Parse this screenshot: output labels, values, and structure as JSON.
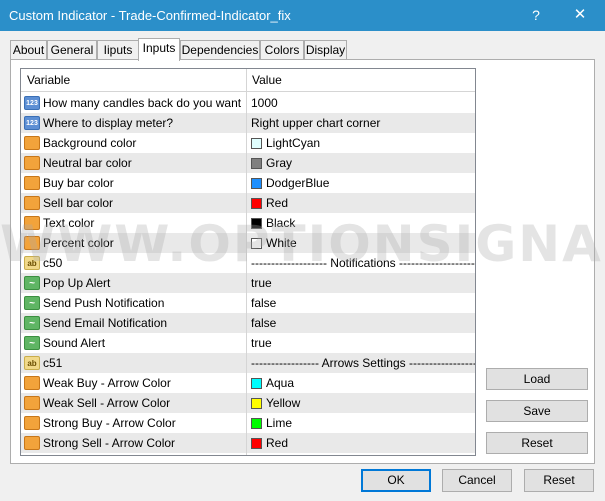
{
  "window": {
    "title": "Custom Indicator - Trade-Confirmed-Indicator_fix",
    "help_glyph": "?",
    "close_glyph": "✕"
  },
  "tabs": [
    "About",
    "General",
    "Iiputs",
    "Inputs",
    "Dependencies",
    "Colors",
    "Display"
  ],
  "active_tab": "Inputs",
  "grid": {
    "headers": {
      "variable": "Variable",
      "value": "Value"
    },
    "rows": [
      {
        "type": "num",
        "icon_text": "123",
        "variable": "How many candles back do you want in...",
        "value": "1000"
      },
      {
        "type": "num",
        "icon_text": "123",
        "variable": "Where to display meter?",
        "value": "Right upper chart corner"
      },
      {
        "type": "color",
        "variable": "Background color",
        "value": "LightCyan",
        "swatch": "#e0ffff"
      },
      {
        "type": "color",
        "variable": "Neutral bar color",
        "value": "Gray",
        "swatch": "#808080"
      },
      {
        "type": "color",
        "variable": "Buy bar color",
        "value": "DodgerBlue",
        "swatch": "#1e90ff"
      },
      {
        "type": "color",
        "variable": "Sell bar color",
        "value": "Red",
        "swatch": "#ff0000"
      },
      {
        "type": "color",
        "variable": "Text color",
        "value": "Black",
        "swatch": "#000000"
      },
      {
        "type": "color",
        "variable": "Percent color",
        "value": "White",
        "swatch": "#ffffff"
      },
      {
        "type": "str",
        "icon_text": "ab",
        "variable": "c50",
        "value": "------------------- Notifications -------------------"
      },
      {
        "type": "bool",
        "icon_text": "~",
        "variable": "Pop Up Alert",
        "value": "true"
      },
      {
        "type": "bool",
        "icon_text": "~",
        "variable": "Send Push Notification",
        "value": "false"
      },
      {
        "type": "bool",
        "icon_text": "~",
        "variable": "Send Email Notification",
        "value": "false"
      },
      {
        "type": "bool",
        "icon_text": "~",
        "variable": "Sound Alert",
        "value": "true"
      },
      {
        "type": "str",
        "icon_text": "ab",
        "variable": "c51",
        "value": "----------------- Arrows Settings -----------------"
      },
      {
        "type": "color",
        "variable": "Weak Buy - Arrow Color",
        "value": "Aqua",
        "swatch": "#00ffff"
      },
      {
        "type": "color",
        "variable": "Weak Sell - Arrow Color",
        "value": "Yellow",
        "swatch": "#ffff00"
      },
      {
        "type": "color",
        "variable": "Strong Buy - Arrow Color",
        "value": "Lime",
        "swatch": "#00ff00"
      },
      {
        "type": "color",
        "variable": "Strong Sell - Arrow Color",
        "value": "Red",
        "swatch": "#ff0000"
      }
    ]
  },
  "side_buttons": {
    "load": "Load",
    "save": "Save",
    "reset": "Reset"
  },
  "bottom_buttons": {
    "ok": "OK",
    "cancel": "Cancel",
    "reset": "Reset"
  },
  "watermark": "WWW.OPTIONSIGNALS.COM",
  "colors": {
    "titlebar": "#2b8fc9",
    "alt_row": "#e9e9e9",
    "default_button_border": "#0078d7"
  }
}
